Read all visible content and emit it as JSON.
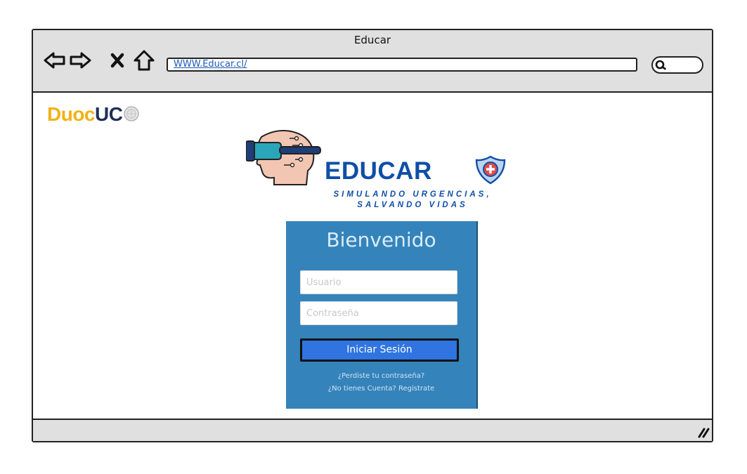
{
  "window": {
    "title": "Educar"
  },
  "toolbar": {
    "back_icon": "arrow-left-outline-icon",
    "forward_icon": "arrow-right-outline-icon",
    "stop_icon": "close-x-icon",
    "home_icon": "home-icon",
    "url": "WWW.Educar.cl/",
    "search_icon": "search-icon"
  },
  "brand": {
    "duoc": "Duoc",
    "uc": "UC"
  },
  "logo": {
    "title": "EDUCAR",
    "tagline_1": "SIMULANDO URGENCIAS,",
    "tagline_2": "SALVANDO VIDAS"
  },
  "login": {
    "title": "Bienvenido",
    "username_placeholder": "Usuario",
    "password_placeholder": "Contraseña",
    "submit_label": "Iniciar Sesión",
    "forgot_link": "¿Perdiste tu contraseña?",
    "register_link": "¿No tienes Cuenta? Registrate"
  },
  "colors": {
    "panel": "#3583bb",
    "button": "#2f74e0",
    "brand_blue": "#0f4ea8",
    "duoc_yellow": "#f2b116",
    "duoc_navy": "#1e2f57"
  }
}
